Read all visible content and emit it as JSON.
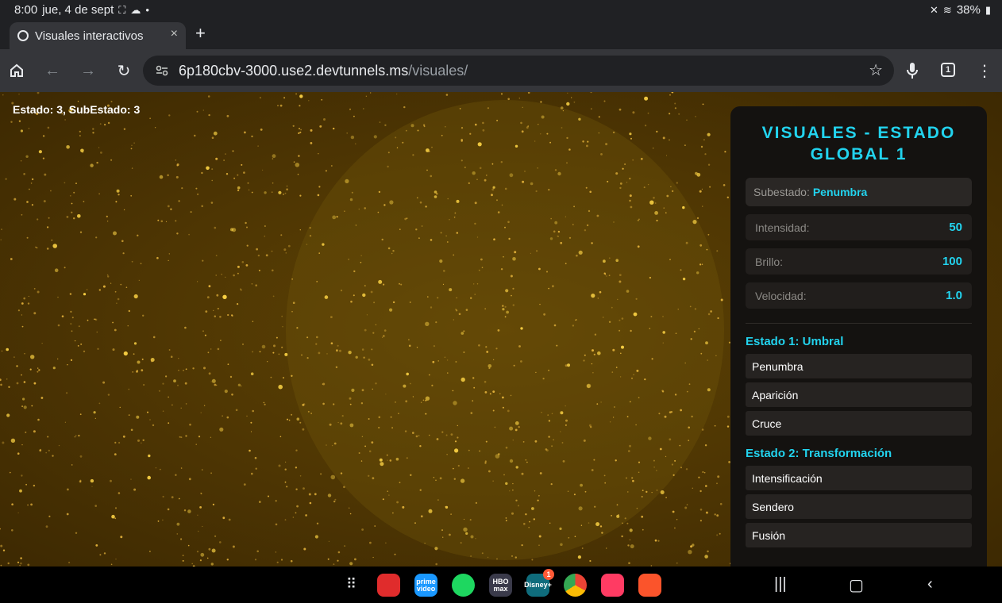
{
  "status_bar": {
    "time": "8:00",
    "date": "jue, 4 de sept",
    "battery": "38%"
  },
  "browser": {
    "tab_title": "Visuales interactivos",
    "close_glyph": "×",
    "new_tab_glyph": "+",
    "url_host": "6p180cbv-3000.use2.devtunnels.ms",
    "url_path": "/visuales/",
    "tab_count": "1"
  },
  "page": {
    "state_label": "Estado: 3, SubEstado: 3",
    "panel": {
      "title": "VISUALES - ESTADO GLOBAL 1",
      "substate_label": "Subestado:",
      "substate_value": "Penumbra",
      "metrics": [
        {
          "label": "Intensidad:",
          "value": "50"
        },
        {
          "label": "Brillo:",
          "value": "100"
        },
        {
          "label": "Velocidad:",
          "value": "1.0"
        }
      ],
      "sections": [
        {
          "heading": "Estado 1: Umbral",
          "options": [
            "Penumbra",
            "Aparición",
            "Cruce"
          ]
        },
        {
          "heading": "Estado 2: Transformación",
          "options": [
            "Intensificación",
            "Sendero",
            "Fusión"
          ]
        }
      ]
    }
  },
  "colors": {
    "accent": "#22d3ee",
    "background_gold": "#5e4304",
    "panel_bg": "#141210"
  },
  "taskbar": {
    "apps": [
      {
        "name": "flipboard-app-icon",
        "label": "",
        "color": "#e02c2c"
      },
      {
        "name": "prime-video-app-icon",
        "label": "prime video",
        "color": "#1a98ff"
      },
      {
        "name": "spotify-app-icon",
        "label": "",
        "color": "#1ed760"
      },
      {
        "name": "hbo-max-app-icon",
        "label": "HBO max",
        "color": "#3a3a4a"
      },
      {
        "name": "disney-plus-app-icon",
        "label": "Disney+",
        "color": "#0f6c7c",
        "badge": "1"
      },
      {
        "name": "chrome-app-icon",
        "label": "",
        "color": "#ffffff"
      },
      {
        "name": "camera-app-icon",
        "label": "",
        "color": "#ff3b63"
      },
      {
        "name": "brave-app-icon",
        "label": "",
        "color": "#ffffff"
      }
    ]
  }
}
